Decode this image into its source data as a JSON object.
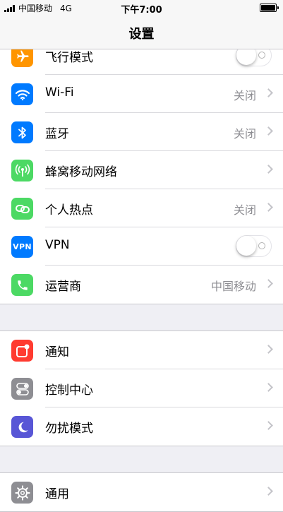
{
  "status_bar": {
    "carrier": "中国移动",
    "network": "4G",
    "time": "下午7:00"
  },
  "nav": {
    "title": "设置"
  },
  "groups": [
    {
      "rows": [
        {
          "label": "飞行模式",
          "icon": "airplane-icon",
          "color": "#ff9500",
          "toggle": "off"
        },
        {
          "label": "Wi-Fi",
          "value": "关闭",
          "icon": "wifi-icon",
          "color": "#007aff"
        },
        {
          "label": "蓝牙",
          "value": "关闭",
          "icon": "bluetooth-icon",
          "color": "#007aff"
        },
        {
          "label": "蜂窝移动网络",
          "icon": "cellular-icon",
          "color": "#4cd964"
        },
        {
          "label": "个人热点",
          "value": "关闭",
          "icon": "hotspot-icon",
          "color": "#4cd964"
        },
        {
          "label": "VPN",
          "icon_text": "VPN",
          "color": "#007aff",
          "toggle": "off"
        },
        {
          "label": "运营商",
          "value": "中国移动",
          "icon": "phone-icon",
          "color": "#4cd964"
        }
      ]
    },
    {
      "rows": [
        {
          "label": "通知",
          "icon": "notifications-icon",
          "color": "#ff3b30"
        },
        {
          "label": "控制中心",
          "icon": "control-center-icon",
          "color": "#8e8e93"
        },
        {
          "label": "勿扰模式",
          "icon": "moon-icon",
          "color": "#5856d6"
        }
      ]
    },
    {
      "rows": [
        {
          "label": "通用",
          "icon": "gear-icon",
          "color": "#8e8e93"
        }
      ]
    }
  ]
}
